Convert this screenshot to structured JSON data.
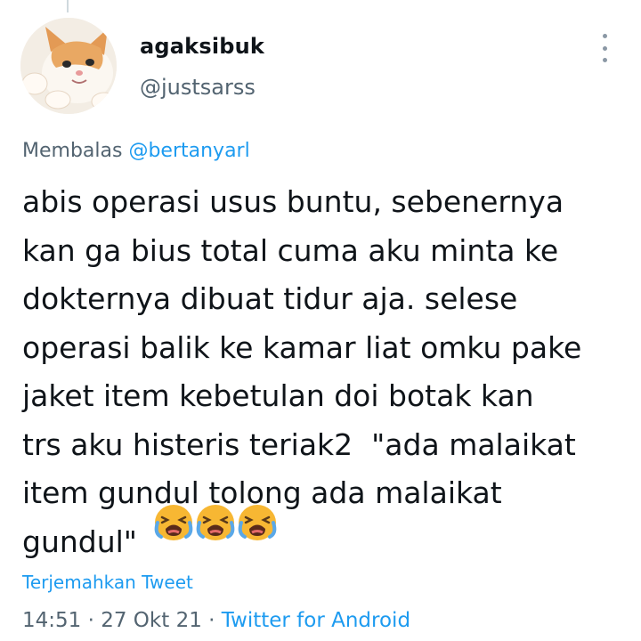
{
  "tweet": {
    "display_name": "agaksibuk",
    "handle": "@justsarss",
    "reply_prefix": "Membalas",
    "reply_mention": "@bertanyarl",
    "text": "abis operasi usus buntu, sebenernya\nkan ga bius total cuma aku minta ke\ndokternya dibuat tidur aja. selese\noperasi balik ke kamar liat omku pake\njaket item kebetulan doi botak kan\ntrs aku histeris teriak2  \"ada malaikat\nitem gundul tolong ada malaikat\ngundul\"",
    "emojis": [
      "crying-face-emoji",
      "crying-face-emoji",
      "crying-face-emoji"
    ],
    "translate_label": "Terjemahkan Tweet",
    "time": "14:51",
    "date": "27 Okt 21",
    "separator": "·",
    "source": "Twitter for Android"
  },
  "colors": {
    "text": "#0f1419",
    "secondary": "#536471",
    "link": "#1d9bf0",
    "emoji_face": "#f7b733"
  },
  "icons": {
    "more": "more-vertical-icon"
  }
}
